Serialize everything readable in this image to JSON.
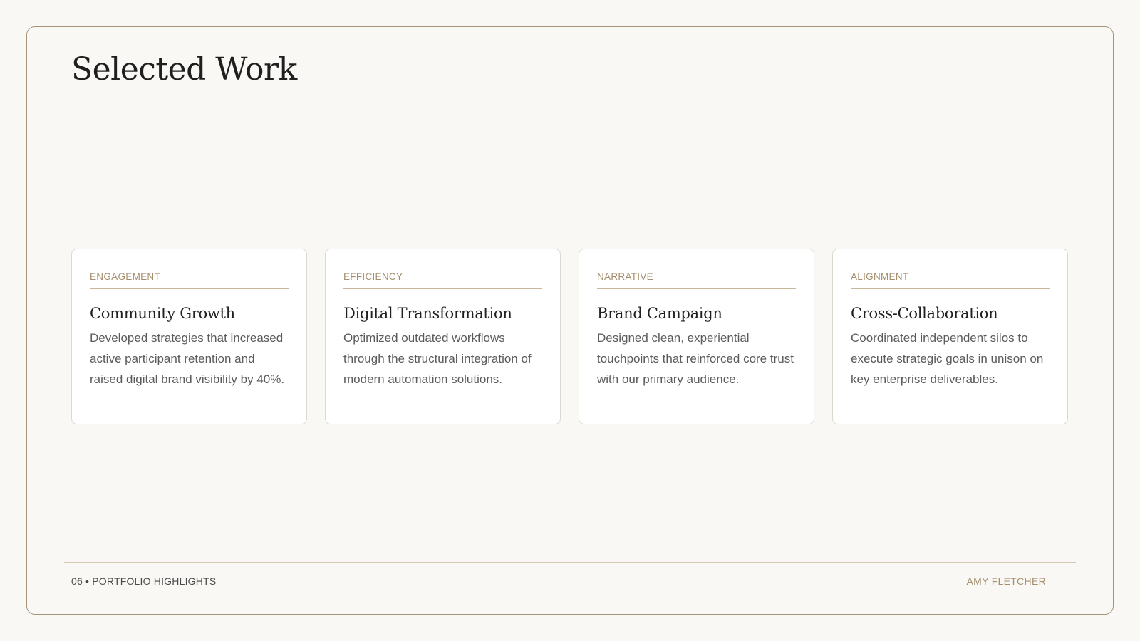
{
  "slide": {
    "title": "Selected Work"
  },
  "cards": [
    {
      "tag": "ENGAGEMENT",
      "title": "Community Growth",
      "description": "Developed strategies that increased active participant retention and raised digital brand visibility by 40%."
    },
    {
      "tag": "EFFICIENCY",
      "title": "Digital Transformation",
      "description": "Optimized outdated workflows through the structural integration of modern automation solutions."
    },
    {
      "tag": "NARRATIVE",
      "title": "Brand Campaign",
      "description": "Designed clean, experiential touchpoints that reinforced core trust with our primary audience."
    },
    {
      "tag": "ALIGNMENT",
      "title": "Cross-Collaboration",
      "description": "Coordinated independent silos to execute strategic goals in unison on key enterprise deliverables."
    }
  ],
  "footer": {
    "section": "06 • PORTFOLIO HIGHLIGHTS",
    "author": "AMY FLETCHER"
  },
  "colors": {
    "accent": "#a58e6c",
    "frame_border": "#a6947a",
    "background": "#f9f8f5"
  }
}
